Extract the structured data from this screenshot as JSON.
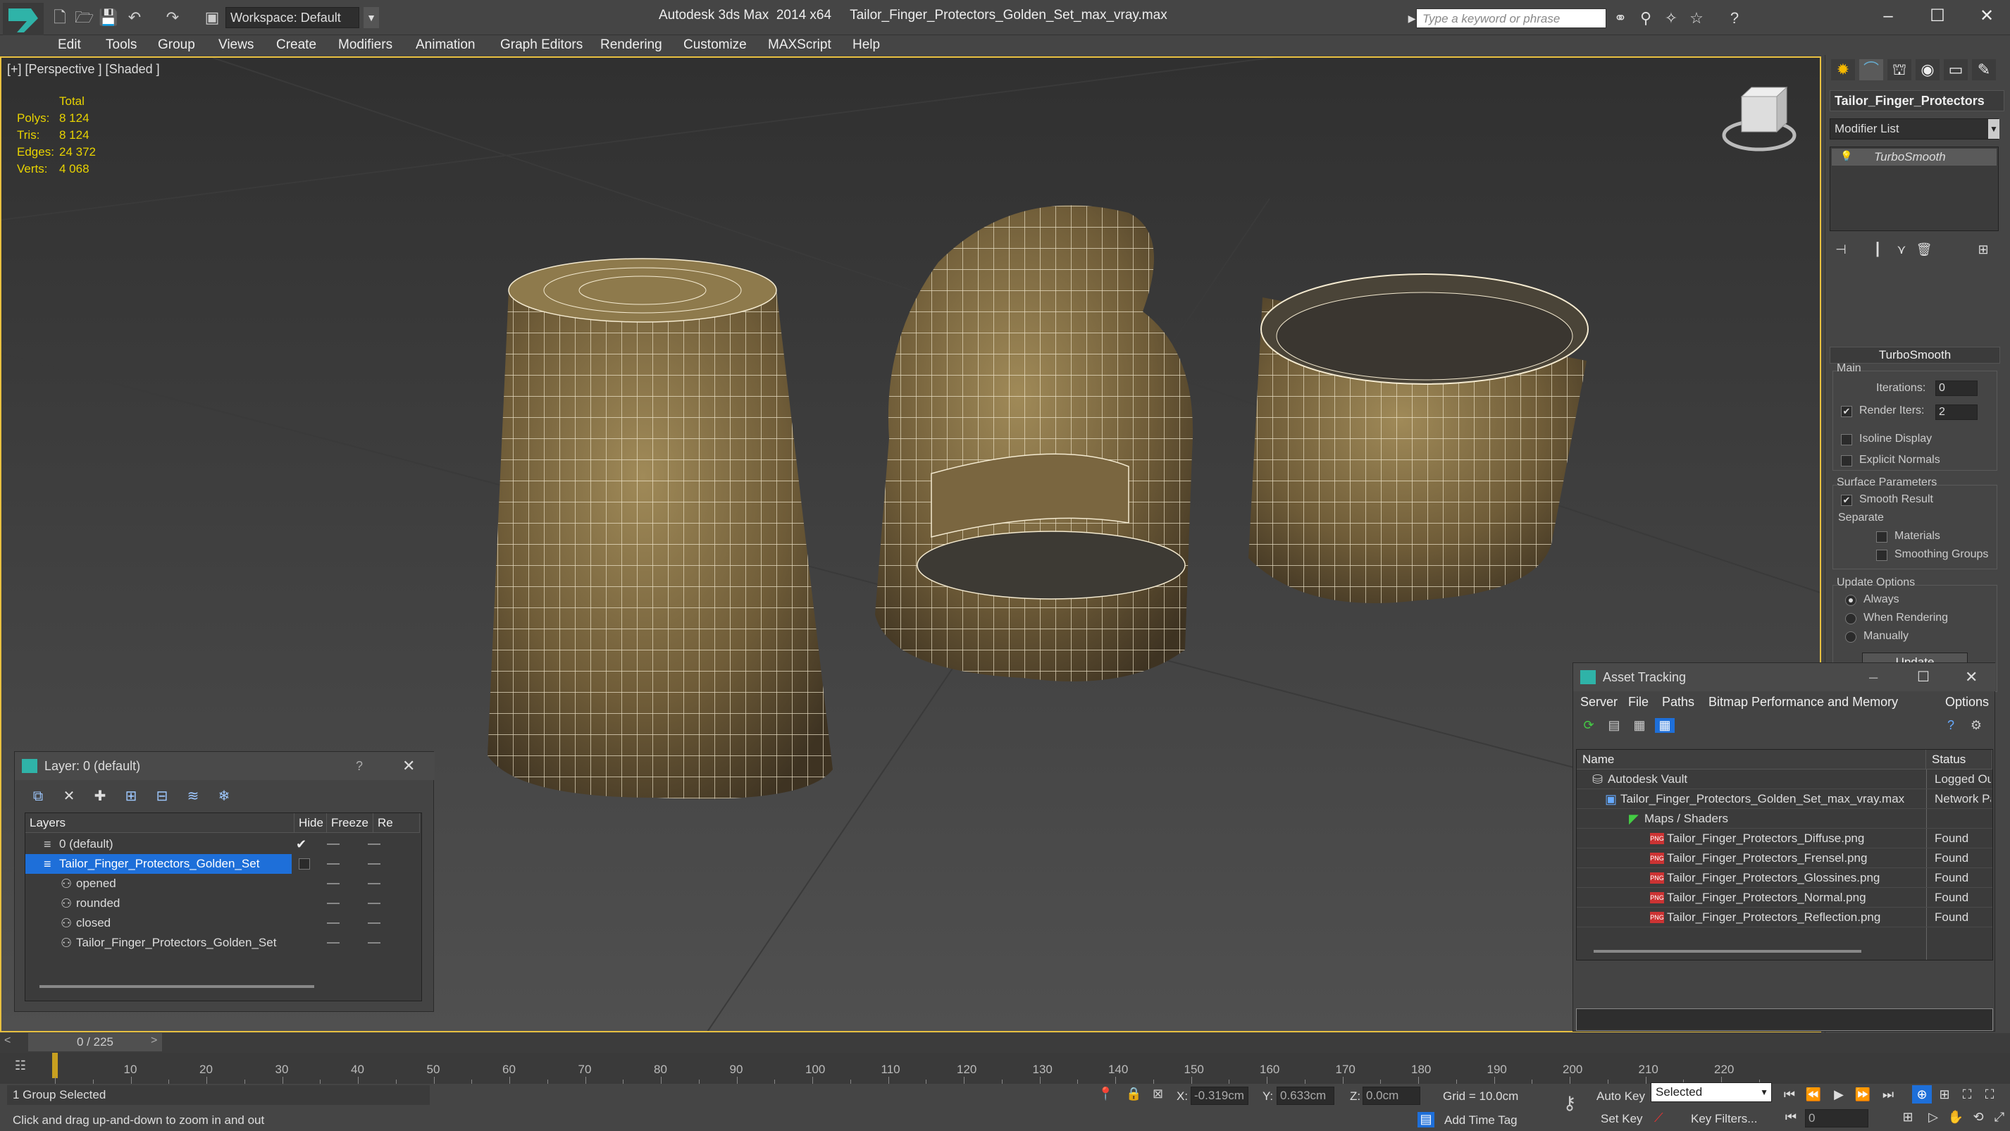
{
  "titlebar": {
    "app_title": "Autodesk 3ds Max  2014 x64",
    "file_title": "Tailor_Finger_Protectors_Golden_Set_max_vray.max",
    "workspace_label": "Workspace: Default",
    "search_placeholder": "Type a keyword or phrase"
  },
  "menubar": [
    "Edit",
    "Tools",
    "Group",
    "Views",
    "Create",
    "Modifiers",
    "Animation",
    "Graph Editors",
    "Rendering",
    "Customize",
    "MAXScript",
    "Help"
  ],
  "viewport": {
    "label": "[+] [Perspective ] [Shaded ]",
    "stats": {
      "header": "Total",
      "rows": [
        {
          "k": "Polys:",
          "v": "8 124"
        },
        {
          "k": "Tris:",
          "v": "8 124"
        },
        {
          "k": "Edges:",
          "v": "24 372"
        },
        {
          "k": "Verts:",
          "v": "4 068"
        }
      ]
    }
  },
  "command_panel": {
    "object_name": "Tailor_Finger_Protectors",
    "modifier_list": "Modifier List",
    "stack_item": "TurboSmooth",
    "rollout_title": "TurboSmooth",
    "main_group": "Main",
    "iterations_label": "Iterations:",
    "iterations_value": "0",
    "render_iters_label": "Render Iters:",
    "render_iters_value": "2",
    "isoline_label": "Isoline Display",
    "explicit_label": "Explicit Normals",
    "surface_group": "Surface Parameters",
    "smooth_label": "Smooth Result",
    "separate_label": "Separate",
    "materials_label": "Materials",
    "smoothing_label": "Smoothing Groups",
    "update_group": "Update Options",
    "always_label": "Always",
    "when_rendering_label": "When Rendering",
    "manually_label": "Manually",
    "update_button": "Update"
  },
  "layer_window": {
    "title": "Layer: 0 (default)",
    "help": "?",
    "columns": [
      "Layers",
      "Hide",
      "Freeze",
      "Re"
    ],
    "rows": [
      {
        "name": "0 (default)"
      },
      {
        "name": "Tailor_Finger_Protectors_Golden_Set"
      },
      {
        "name": "opened"
      },
      {
        "name": "rounded"
      },
      {
        "name": "closed"
      },
      {
        "name": "Tailor_Finger_Protectors_Golden_Set"
      }
    ]
  },
  "asset_window": {
    "title": "Asset Tracking",
    "menu": [
      "Server",
      "File",
      "Paths",
      "Bitmap Performance and Memory",
      "Options"
    ],
    "columns": [
      "Name",
      "Status"
    ],
    "rows": [
      {
        "name": "Autodesk Vault",
        "status": "Logged Ou"
      },
      {
        "name": "Tailor_Finger_Protectors_Golden_Set_max_vray.max",
        "status": "Network Pa"
      },
      {
        "name": "Maps / Shaders",
        "status": ""
      },
      {
        "name": "Tailor_Finger_Protectors_Diffuse.png",
        "status": "Found"
      },
      {
        "name": "Tailor_Finger_Protectors_Frensel.png",
        "status": "Found"
      },
      {
        "name": "Tailor_Finger_Protectors_Glossines.png",
        "status": "Found"
      },
      {
        "name": "Tailor_Finger_Protectors_Normal.png",
        "status": "Found"
      },
      {
        "name": "Tailor_Finger_Protectors_Reflection.png",
        "status": "Found"
      }
    ]
  },
  "timeline": {
    "frame_indicator": "0 / 225",
    "ticks": [
      "10",
      "20",
      "30",
      "40",
      "50",
      "60",
      "70",
      "80",
      "90",
      "100",
      "110",
      "120",
      "130",
      "140",
      "150",
      "160",
      "170",
      "180",
      "190",
      "200",
      "210",
      "220"
    ]
  },
  "statusbar": {
    "selection": "1 Group Selected",
    "prompt": "Click and drag up-and-down to zoom in and out",
    "x_label": "X:",
    "x_value": "-0.319cm",
    "y_label": "Y:",
    "y_value": "0.633cm",
    "z_label": "Z:",
    "z_value": "0.0cm",
    "grid": "Grid = 10.0cm",
    "add_time_tag": "Add Time Tag",
    "auto_key": "Auto Key",
    "set_key": "Set Key",
    "selected": "Selected",
    "key_filters": "Key Filters...",
    "frame_value": "0"
  },
  "colors": {
    "stats_text": "#e8d300",
    "selection_blue": "#1e6fd9",
    "viewport_border": "#e8c040",
    "gold": "#8b7448"
  }
}
